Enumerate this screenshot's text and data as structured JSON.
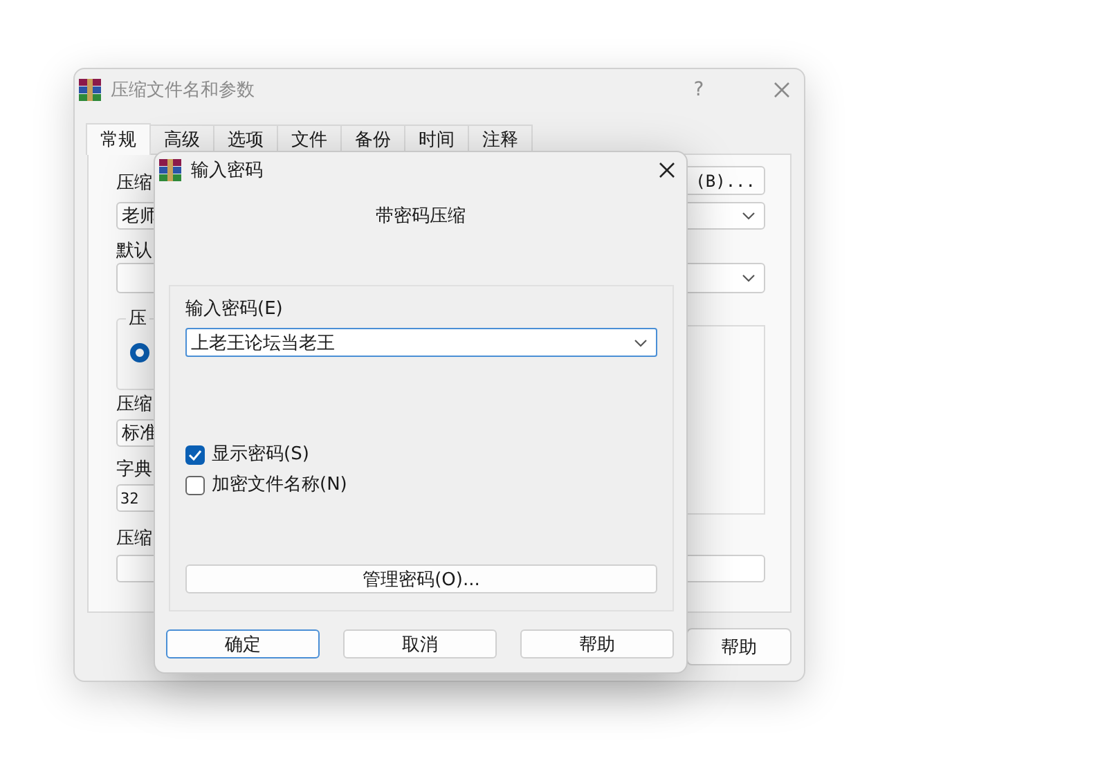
{
  "back_window": {
    "title": "压缩文件名和参数",
    "help_mark": "?",
    "tabs": [
      {
        "label": "常规",
        "selected": true
      },
      {
        "label": "高级",
        "selected": false
      },
      {
        "label": "选项",
        "selected": false
      },
      {
        "label": "文件",
        "selected": false
      },
      {
        "label": "备份",
        "selected": false
      },
      {
        "label": "时间",
        "selected": false
      },
      {
        "label": "注释",
        "selected": false
      }
    ],
    "archive_name_label": "压缩",
    "browse_button": "(B)...",
    "archive_name_value": "老师",
    "profile_label": "默认",
    "format_group_label": "压",
    "format_radio": {
      "selected": true
    },
    "method_label": "压缩",
    "method_value": "标准",
    "dictionary_label": "字典",
    "dictionary_value": "32",
    "split_label": "压缩",
    "help_button": "帮助"
  },
  "dialog": {
    "title": "输入密码",
    "heading": "带密码压缩",
    "password_label": "输入密码(E)",
    "password_value": "上老王论坛当老王",
    "options": [
      {
        "label": "显示密码(S)",
        "checked": true
      },
      {
        "label": "加密文件名称(N)",
        "checked": false
      }
    ],
    "manage_button": "管理密码(O)...",
    "buttons": [
      {
        "label": "确定",
        "default": true
      },
      {
        "label": "取消",
        "default": false
      },
      {
        "label": "帮助",
        "default": false
      }
    ]
  }
}
